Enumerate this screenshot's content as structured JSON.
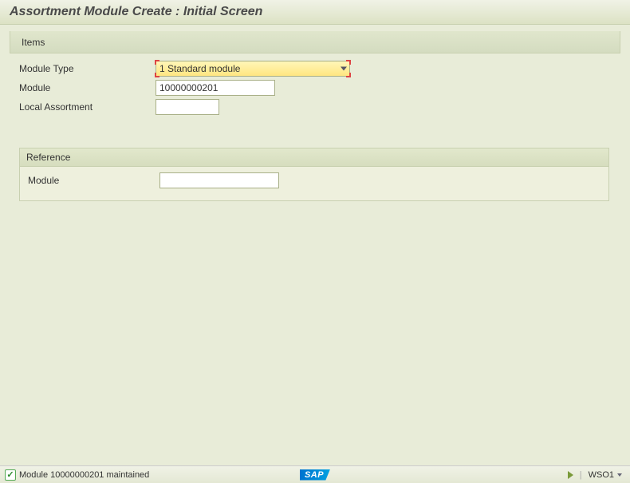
{
  "header": {
    "title": "Assortment Module  Create : Initial Screen"
  },
  "toolbar": {
    "items_label": "Items"
  },
  "fields": {
    "module_type": {
      "label": "Module Type",
      "value": "1 Standard module"
    },
    "module": {
      "label": "Module",
      "value": "10000000201"
    },
    "local_assortment": {
      "label": "Local Assortment",
      "value": ""
    }
  },
  "reference": {
    "title": "Reference",
    "module": {
      "label": "Module",
      "value": ""
    }
  },
  "status": {
    "message": "Module 10000000201 maintained",
    "logo": "SAP",
    "tcode": "WSO1"
  }
}
